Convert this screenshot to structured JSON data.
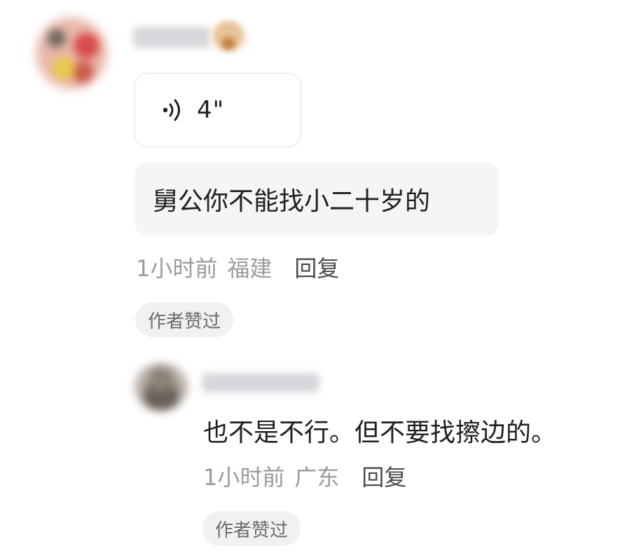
{
  "comment": {
    "voice": {
      "duration": "4\"",
      "icon": "voice-wave-icon"
    },
    "text": "舅公你不能找小二十岁的",
    "meta": {
      "time": "1小时前",
      "location": "福建",
      "reply_label": "回复"
    },
    "liked_badge": "作者赞过"
  },
  "reply": {
    "text": "也不是不行。但不要找擦边的。",
    "meta": {
      "time": "1小时前",
      "location": "广东",
      "reply_label": "回复"
    },
    "liked_badge": "作者赞过"
  },
  "colors": {
    "primary_text": "#1f1f1f",
    "meta_text": "#9a9aa0",
    "reply_button": "#4a4a4f",
    "bubble_background": "#f5f5f7",
    "chip_background": "#f1f1f3"
  }
}
